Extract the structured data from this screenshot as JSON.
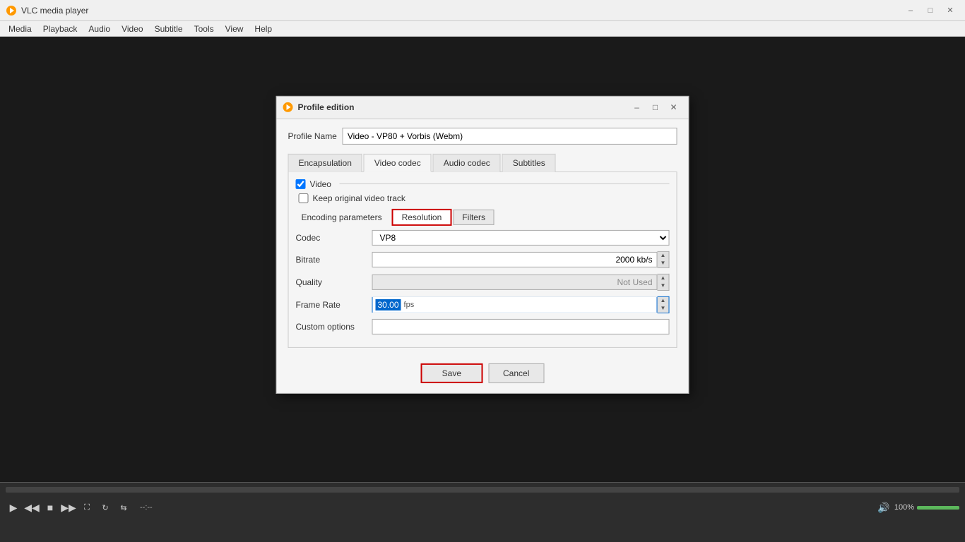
{
  "app": {
    "title": "VLC media player",
    "icon": "▶"
  },
  "menu": {
    "items": [
      "Media",
      "Playback",
      "Audio",
      "Video",
      "Subtitle",
      "Tools",
      "View",
      "Help"
    ]
  },
  "player": {
    "time_current": "--:--",
    "time_total": "--:--",
    "volume_percent": "100%"
  },
  "modal": {
    "title": "Profile edition",
    "profile_name_label": "Profile Name",
    "profile_name_value": "Video - VP80 + Vorbis (Webm)",
    "tabs": [
      "Encapsulation",
      "Video codec",
      "Audio codec",
      "Subtitles"
    ],
    "active_tab": "Video codec",
    "video_checkbox_label": "Video",
    "video_checked": true,
    "keep_original_label": "Keep original video track",
    "keep_original_checked": false,
    "sub_tab_label": "Encoding parameters",
    "sub_tabs": [
      "Resolution",
      "Filters"
    ],
    "active_sub_tab": "Resolution",
    "fields": {
      "codec_label": "Codec",
      "codec_value": "VP8",
      "bitrate_label": "Bitrate",
      "bitrate_value": "2000 kb/s",
      "quality_label": "Quality",
      "quality_value": "Not Used",
      "framerate_label": "Frame Rate",
      "framerate_value": "30.00",
      "framerate_unit": "fps",
      "custom_options_label": "Custom options",
      "custom_options_value": ""
    },
    "buttons": {
      "save": "Save",
      "cancel": "Cancel"
    }
  }
}
